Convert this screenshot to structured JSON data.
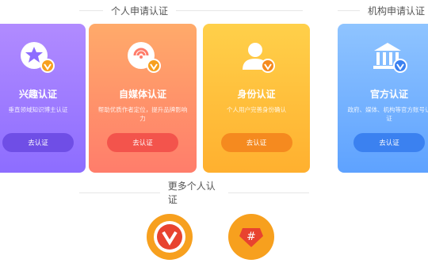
{
  "sections": {
    "personal_title": "个人申请认证",
    "org_title": "机构申请认证",
    "more_title": "更多个人认证"
  },
  "cards": [
    {
      "title": "兴趣认证",
      "desc": "垂直领域知识博主认证",
      "button": "去认证",
      "icon": "star-icon",
      "color": "#8d6dff"
    },
    {
      "title": "自媒体认证",
      "desc": "帮助优质作者定位，提升品牌影响力",
      "button": "去认证",
      "icon": "media-broadcast-icon",
      "color": "#ff7d6b"
    },
    {
      "title": "身份认证",
      "desc": "个人用户完善身份确认",
      "button": "去认证",
      "icon": "person-icon",
      "color": "#ffb02f"
    },
    {
      "title": "官方认证",
      "desc": "政府、媒体、机构等官方账号认证",
      "button": "去认证",
      "icon": "government-building-icon",
      "color": "#5ea2ff"
    }
  ],
  "more_icons": [
    {
      "icon": "v-badge-icon",
      "color": "#f7a01e"
    },
    {
      "icon": "hashtag-icon",
      "color": "#f7a01e"
    }
  ]
}
